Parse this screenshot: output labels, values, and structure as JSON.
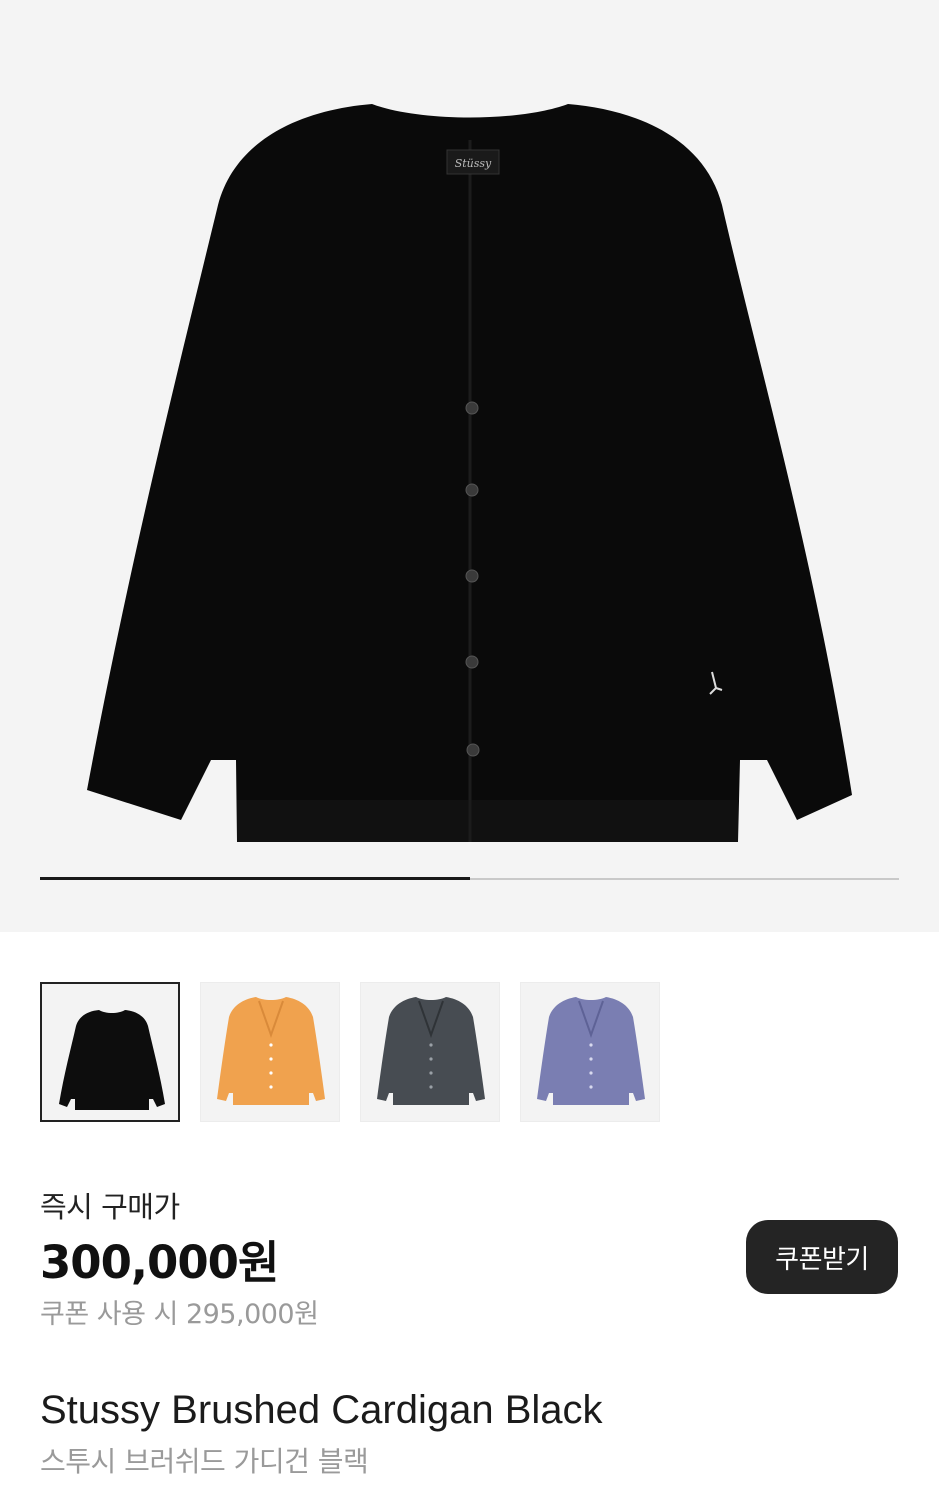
{
  "hero": {
    "image_icon": "black-cardigan-product-image",
    "garment_color": "#0a0a0a",
    "background_color": "#f4f4f4",
    "brand_logo_text": "Stüssy",
    "carousel_progress": 0.5
  },
  "thumbnails": [
    {
      "color_name": "black",
      "color": "#0d0d0d",
      "selected": true
    },
    {
      "color_name": "orange",
      "color": "#f0a24e",
      "selected": false
    },
    {
      "color_name": "charcoal",
      "color": "#474c52",
      "selected": false
    },
    {
      "color_name": "lavender",
      "color": "#7a7eb2",
      "selected": false
    }
  ],
  "price": {
    "label": "즉시 구매가",
    "value": "300,000원",
    "coupon_text": "쿠폰 사용 시 295,000원"
  },
  "coupon_button": {
    "label": "쿠폰받기"
  },
  "product": {
    "name": "Stussy Brushed Cardigan Black",
    "subname": "스투시 브러쉬드 가디건 블랙"
  }
}
